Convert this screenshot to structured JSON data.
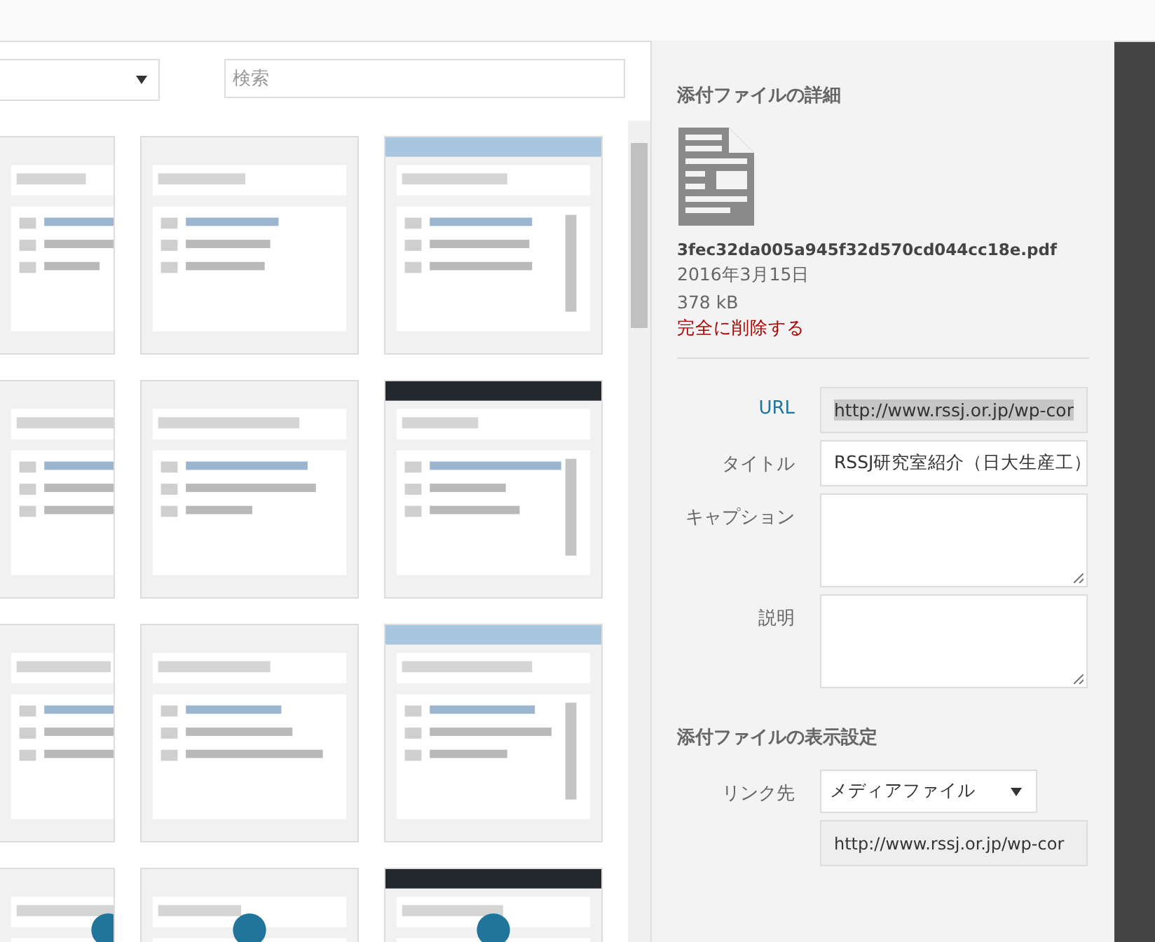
{
  "toolbar": {
    "search": {
      "placeholder": "検索"
    }
  },
  "details": {
    "heading": "添付ファイルの詳細",
    "filename": "3fec32da005a945f32d570cd044cc18e.pdf",
    "date": "2016年3月15日",
    "size": "378 kB",
    "delete_link": "完全に削除する"
  },
  "fields": [
    {
      "kind": "readonly",
      "label": "URL",
      "value": "http://www.rssj.or.jp/wp-cor"
    },
    {
      "kind": "text",
      "label": "タイトル",
      "value": "RSSJ研究室紹介（日大生産工）"
    },
    {
      "kind": "textarea",
      "label": "キャプション"
    },
    {
      "kind": "textarea",
      "label": "説明"
    }
  ],
  "display_settings": {
    "heading": "添付ファイルの表示設定",
    "link_label": "リンク先",
    "link_value": "メディアファイル",
    "link_url": "http://www.rssj.or.jp/wp-cor"
  }
}
